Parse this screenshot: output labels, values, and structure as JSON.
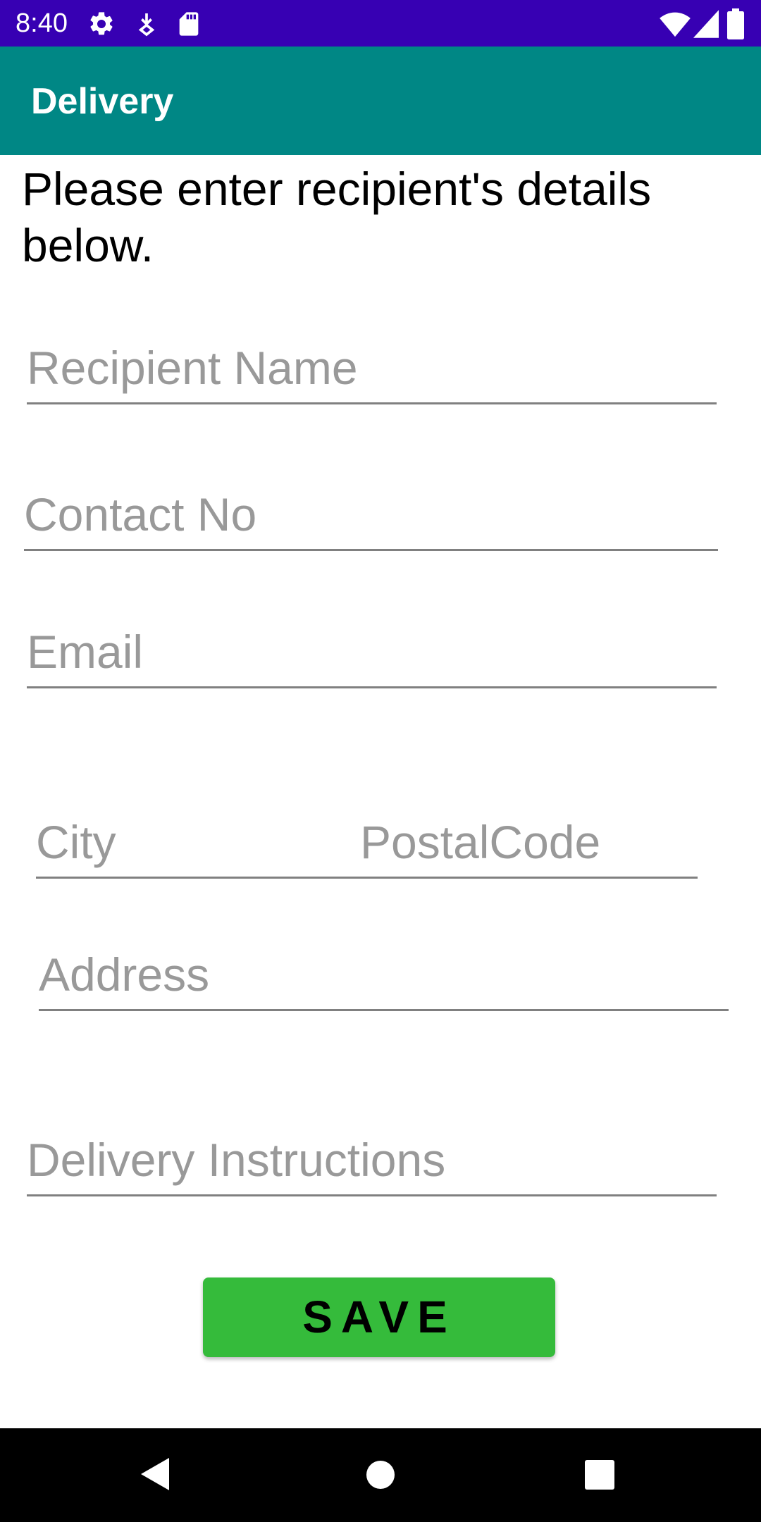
{
  "status_bar": {
    "time": "8:40",
    "background": "#3700b3",
    "icons_left": [
      "settings-icon",
      "download-icon",
      "sd-card-icon"
    ],
    "icons_right": [
      "wifi-icon",
      "signal-icon",
      "battery-icon"
    ]
  },
  "app_bar": {
    "title": "Delivery",
    "background": "#008785"
  },
  "form": {
    "intro": "Please enter recipient's details below.",
    "recipient_name": {
      "placeholder": "Recipient Name",
      "value": ""
    },
    "contact_no": {
      "placeholder": "Contact No",
      "value": ""
    },
    "email": {
      "placeholder": "Email",
      "value": ""
    },
    "city": {
      "placeholder": "City",
      "value": ""
    },
    "postal_code": {
      "placeholder": "PostalCode",
      "value": ""
    },
    "address": {
      "placeholder": "Address",
      "value": ""
    },
    "delivery_instructions": {
      "placeholder": "Delivery Instructions",
      "value": ""
    },
    "save_label": "SAVE",
    "save_color": "#35bb3b"
  },
  "nav_bar": {
    "buttons": [
      "back-icon",
      "home-icon",
      "recents-icon"
    ]
  }
}
